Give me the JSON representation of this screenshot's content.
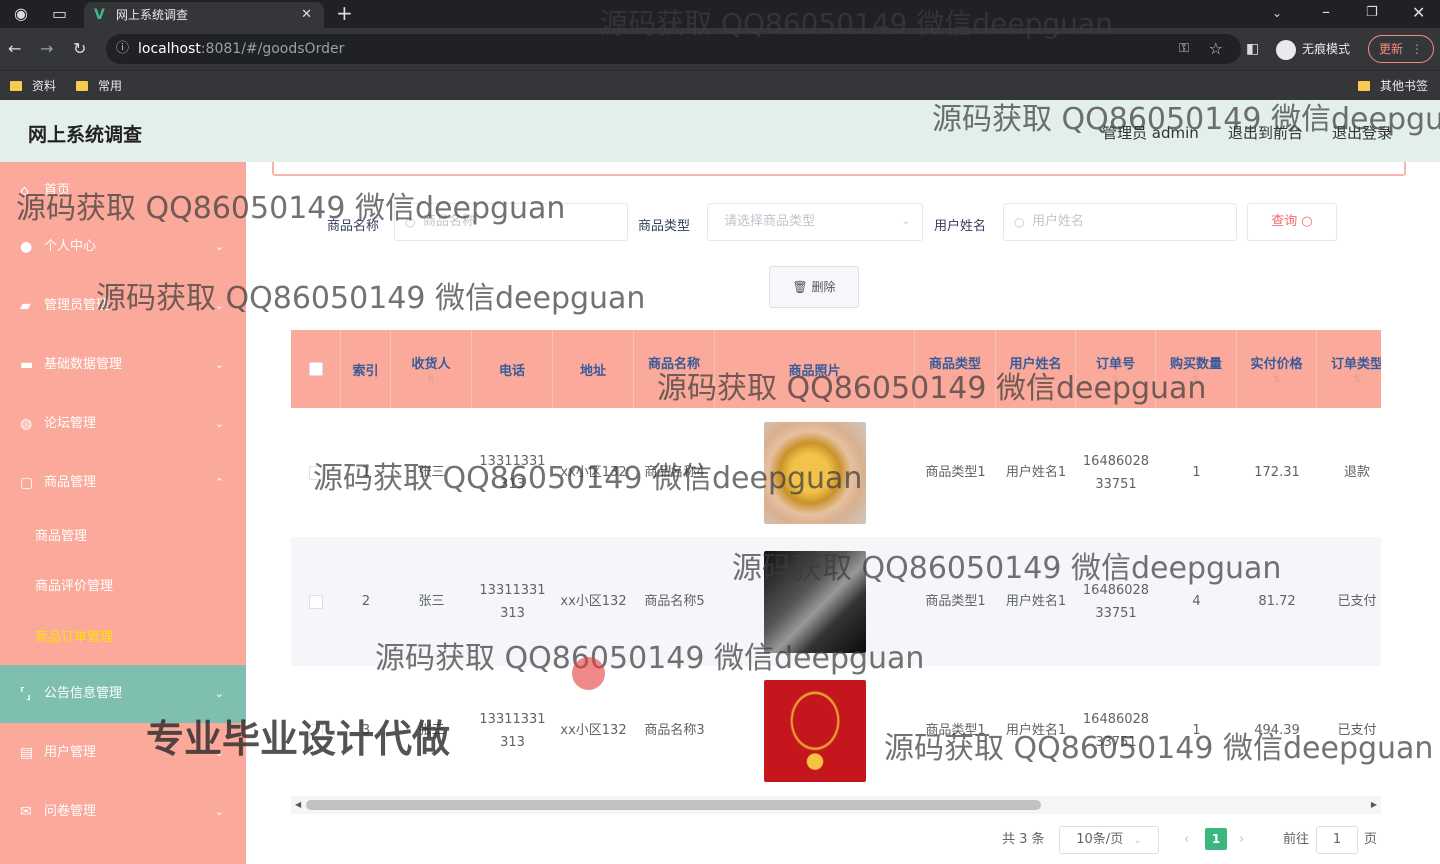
{
  "browser": {
    "tab_title": "网上系统调查",
    "tab_close": "✕",
    "url_host": "localhost",
    "url_path": ":8081/#/goodsOrder",
    "incognito_label": "无痕模式",
    "update_label": "更新",
    "bookmarks": [
      "资料",
      "常用"
    ],
    "other_bookmarks": "其他书签"
  },
  "header": {
    "title": "网上系统调查",
    "admin": "管理员 admin",
    "back_front": "退出到前台",
    "logout": "退出登录"
  },
  "sidebar": {
    "items": [
      {
        "label": "首页",
        "icon": "home-icon"
      },
      {
        "label": "个人中心",
        "icon": "user-icon"
      },
      {
        "label": "管理员管理",
        "icon": "briefcase-icon"
      },
      {
        "label": "基础数据管理",
        "icon": "monitor-icon"
      },
      {
        "label": "论坛管理",
        "icon": "globe-icon"
      },
      {
        "label": "商品管理",
        "icon": "chat-icon"
      }
    ],
    "sub_items": [
      "商品管理",
      "商品评价管理",
      "商品订单管理"
    ],
    "bottom_items": [
      {
        "label": "公告信息管理",
        "icon": "bracket-icon"
      },
      {
        "label": "用户管理",
        "icon": "doc-icon"
      },
      {
        "label": "问卷管理",
        "icon": "mail-icon"
      }
    ]
  },
  "filters": {
    "goods_name_label": "商品名称",
    "goods_name_placeholder": "商品名称",
    "goods_type_label": "商品类型",
    "goods_type_placeholder": "请选择商品类型",
    "user_name_label": "用户姓名",
    "user_name_placeholder": "用户姓名",
    "query_label": "查询",
    "delete_label": "删除"
  },
  "table": {
    "columns": [
      "索引",
      "收货人",
      "电话",
      "地址",
      "商品名称",
      "商品照片",
      "商品类型",
      "用户姓名",
      "订单号",
      "购买数量",
      "实付价格",
      "订单类型"
    ],
    "rows": [
      {
        "index": "1",
        "receiver": "张三",
        "phone": "13311331313",
        "address": "xx小区132",
        "goods_name": "商品名称4",
        "goods_type": "商品类型1",
        "user_name": "用户姓名1",
        "order_no": "1648602833751",
        "qty": "1",
        "price": "172.31",
        "order_type": "退款"
      },
      {
        "index": "2",
        "receiver": "张三",
        "phone": "13311331313",
        "address": "xx小区132",
        "goods_name": "商品名称5",
        "goods_type": "商品类型1",
        "user_name": "用户姓名1",
        "order_no": "1648602833751",
        "qty": "4",
        "price": "81.72",
        "order_type": "已支付"
      },
      {
        "index": "3",
        "receiver": "张三",
        "phone": "13311331313",
        "address": "xx小区132",
        "goods_name": "商品名称3",
        "goods_type": "商品类型1",
        "user_name": "用户姓名1",
        "order_no": "1648602833751",
        "qty": "1",
        "price": "494.39",
        "order_type": "已支付"
      }
    ]
  },
  "pagination": {
    "total": "共 3 条",
    "page_size": "10条/页",
    "current": "1",
    "goto_label": "前往",
    "goto_value": "1",
    "page_suffix": "页"
  },
  "watermark": {
    "text": "源码获取 QQ86050149 微信deepguan",
    "banner": "专业毕业设计代做"
  }
}
